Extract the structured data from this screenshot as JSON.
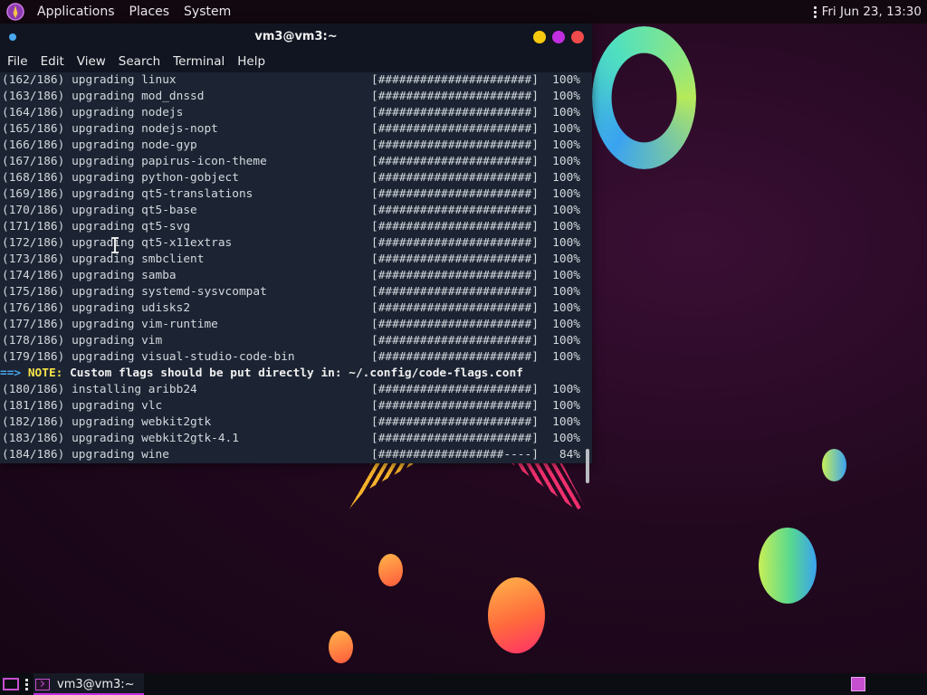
{
  "top_panel": {
    "menus": [
      "Applications",
      "Places",
      "System"
    ],
    "clock": "Fri Jun 23, 13:30"
  },
  "window": {
    "title": "vm3@vm3:~",
    "menus": [
      "File",
      "Edit",
      "View",
      "Search",
      "Terminal",
      "Help"
    ]
  },
  "terminal": {
    "lines": [
      {
        "index": "(162/186)",
        "text": "upgrading linux",
        "bar": "[######################]",
        "percent": "100%"
      },
      {
        "index": "(163/186)",
        "text": "upgrading mod_dnssd",
        "bar": "[######################]",
        "percent": "100%"
      },
      {
        "index": "(164/186)",
        "text": "upgrading nodejs",
        "bar": "[######################]",
        "percent": "100%"
      },
      {
        "index": "(165/186)",
        "text": "upgrading nodejs-nopt",
        "bar": "[######################]",
        "percent": "100%"
      },
      {
        "index": "(166/186)",
        "text": "upgrading node-gyp",
        "bar": "[######################]",
        "percent": "100%"
      },
      {
        "index": "(167/186)",
        "text": "upgrading papirus-icon-theme",
        "bar": "[######################]",
        "percent": "100%"
      },
      {
        "index": "(168/186)",
        "text": "upgrading python-gobject",
        "bar": "[######################]",
        "percent": "100%"
      },
      {
        "index": "(169/186)",
        "text": "upgrading qt5-translations",
        "bar": "[######################]",
        "percent": "100%"
      },
      {
        "index": "(170/186)",
        "text": "upgrading qt5-base",
        "bar": "[######################]",
        "percent": "100%"
      },
      {
        "index": "(171/186)",
        "text": "upgrading qt5-svg",
        "bar": "[######################]",
        "percent": "100%"
      },
      {
        "index": "(172/186)",
        "text": "upgrading qt5-x11extras",
        "bar": "[######################]",
        "percent": "100%"
      },
      {
        "index": "(173/186)",
        "text": "upgrading smbclient",
        "bar": "[######################]",
        "percent": "100%"
      },
      {
        "index": "(174/186)",
        "text": "upgrading samba",
        "bar": "[######################]",
        "percent": "100%"
      },
      {
        "index": "(175/186)",
        "text": "upgrading systemd-sysvcompat",
        "bar": "[######################]",
        "percent": "100%"
      },
      {
        "index": "(176/186)",
        "text": "upgrading udisks2",
        "bar": "[######################]",
        "percent": "100%"
      },
      {
        "index": "(177/186)",
        "text": "upgrading vim-runtime",
        "bar": "[######################]",
        "percent": "100%"
      },
      {
        "index": "(178/186)",
        "text": "upgrading vim",
        "bar": "[######################]",
        "percent": "100%"
      },
      {
        "index": "(179/186)",
        "text": "upgrading visual-studio-code-bin",
        "bar": "[######################]",
        "percent": "100%"
      },
      {
        "note": true,
        "arrow": "==>",
        "label": "NOTE:",
        "message": "Custom flags should be put directly in: ~/.config/code-flags.conf"
      },
      {
        "index": "(180/186)",
        "text": "installing aribb24",
        "bar": "[######################]",
        "percent": "100%"
      },
      {
        "index": "(181/186)",
        "text": "upgrading vlc",
        "bar": "[######################]",
        "percent": "100%"
      },
      {
        "index": "(182/186)",
        "text": "upgrading webkit2gtk",
        "bar": "[######################]",
        "percent": "100%"
      },
      {
        "index": "(183/186)",
        "text": "upgrading webkit2gtk-4.1",
        "bar": "[######################]",
        "percent": "100%"
      },
      {
        "index": "(184/186)",
        "text": "upgrading wine",
        "bar": "[##################----]",
        "percent": "84%"
      }
    ]
  },
  "taskbar": {
    "task_label": "vm3@vm3:~"
  },
  "icons": {
    "app_logo": "distro-logo-icon",
    "workspace": "show-desktop-icon",
    "terminal": "terminal-icon",
    "pager": "workspace-pager-icon"
  },
  "colors": {
    "accent": "#c02ee0",
    "terminal_bg": "#1c2433",
    "note_label": "#f6e34a",
    "note_arrow": "#4aa8f0",
    "min_button": "#f6c90e",
    "max_button": "#c02ee0",
    "close_button": "#f04a4a"
  }
}
